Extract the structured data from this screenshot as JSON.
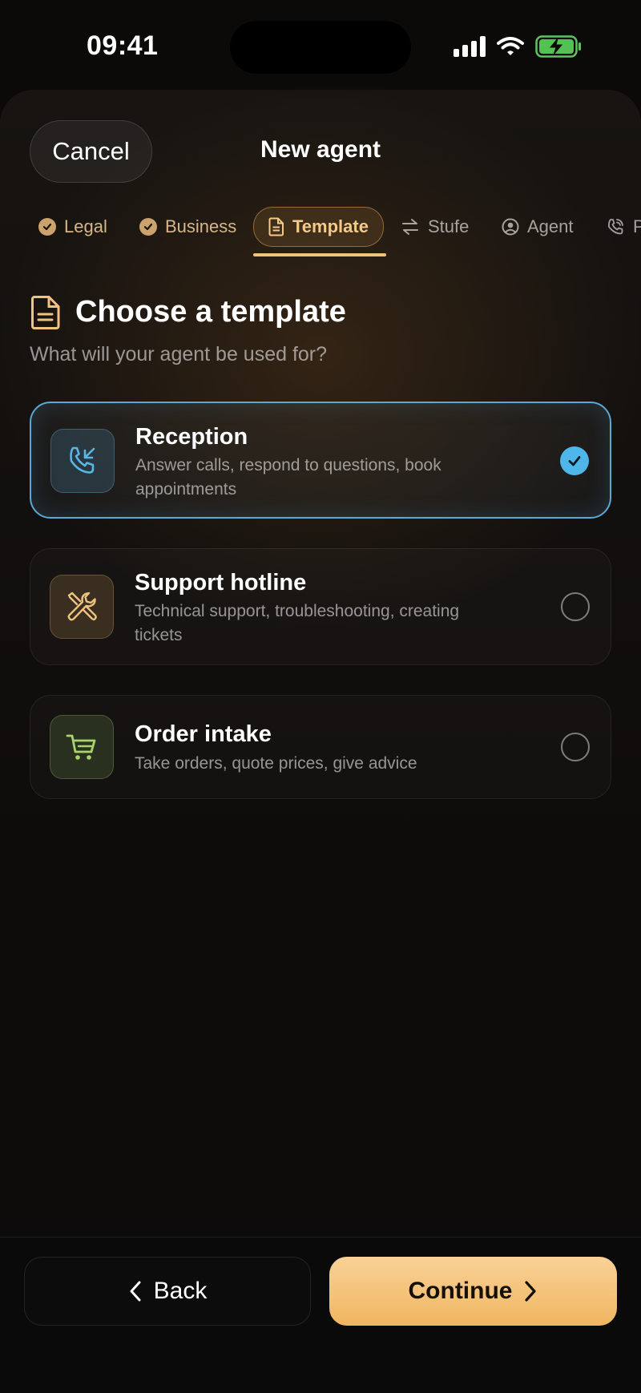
{
  "status_bar": {
    "time": "09:41"
  },
  "nav": {
    "cancel_label": "Cancel",
    "title": "New agent"
  },
  "steps": [
    {
      "label": "Legal",
      "state": "done"
    },
    {
      "label": "Business",
      "state": "done"
    },
    {
      "label": "Template",
      "state": "active"
    },
    {
      "label": "Stufe",
      "state": "pending"
    },
    {
      "label": "Agent",
      "state": "pending"
    },
    {
      "label": "P",
      "state": "pending"
    }
  ],
  "section": {
    "title": "Choose a template",
    "subtitle": "What will your agent be used for?"
  },
  "templates": [
    {
      "title": "Reception",
      "description": "Answer calls, respond to questions, book appointments",
      "icon": "phone-incoming-icon",
      "selected": true
    },
    {
      "title": "Support hotline",
      "description": "Technical support, troubleshooting, creating tickets",
      "icon": "tools-icon",
      "selected": false
    },
    {
      "title": "Order intake",
      "description": "Take orders, quote prices, give advice",
      "icon": "cart-icon",
      "selected": false
    }
  ],
  "footer": {
    "back_label": "Back",
    "continue_label": "Continue"
  },
  "colors": {
    "accent": "#f2c27f",
    "selected_border": "#5aa8d4",
    "check": "#4fb6ea"
  }
}
